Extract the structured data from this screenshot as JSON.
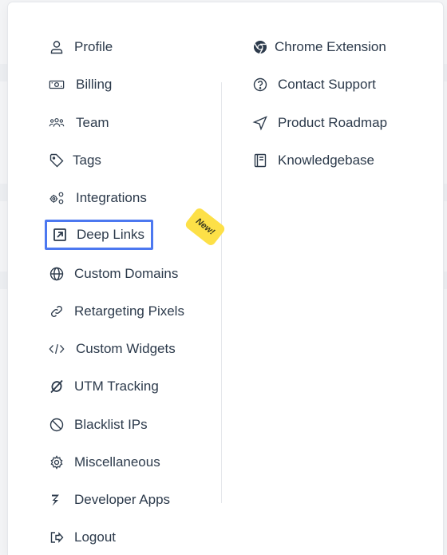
{
  "left_menu": [
    {
      "label": "Profile",
      "icon": "user-icon"
    },
    {
      "label": "Billing",
      "icon": "money-icon"
    },
    {
      "label": "Team",
      "icon": "team-icon"
    },
    {
      "label": "Tags",
      "icon": "tag-icon"
    },
    {
      "label": "Integrations",
      "icon": "integrations-icon"
    },
    {
      "label": "Deep Links",
      "icon": "external-link-icon"
    },
    {
      "label": "Custom Domains",
      "icon": "globe-icon"
    },
    {
      "label": "Retargeting Pixels",
      "icon": "link-icon"
    },
    {
      "label": "Custom Widgets",
      "icon": "code-icon"
    },
    {
      "label": "UTM Tracking",
      "icon": "utm-icon"
    },
    {
      "label": "Blacklist IPs",
      "icon": "ban-icon"
    },
    {
      "label": "Miscellaneous",
      "icon": "gear-icon"
    },
    {
      "label": "Developer Apps",
      "icon": "developer-icon"
    },
    {
      "label": "Logout",
      "icon": "logout-icon"
    }
  ],
  "right_menu": [
    {
      "label": "Chrome Extension",
      "icon": "chrome-icon"
    },
    {
      "label": "Contact Support",
      "icon": "question-icon"
    },
    {
      "label": "Product Roadmap",
      "icon": "navigation-icon"
    },
    {
      "label": "Knowledgebase",
      "icon": "book-icon"
    }
  ],
  "badge": {
    "label": "New!"
  },
  "colors": {
    "text": "#2c3a4b",
    "highlight": "#4c78f0",
    "badge": "#fde047"
  }
}
